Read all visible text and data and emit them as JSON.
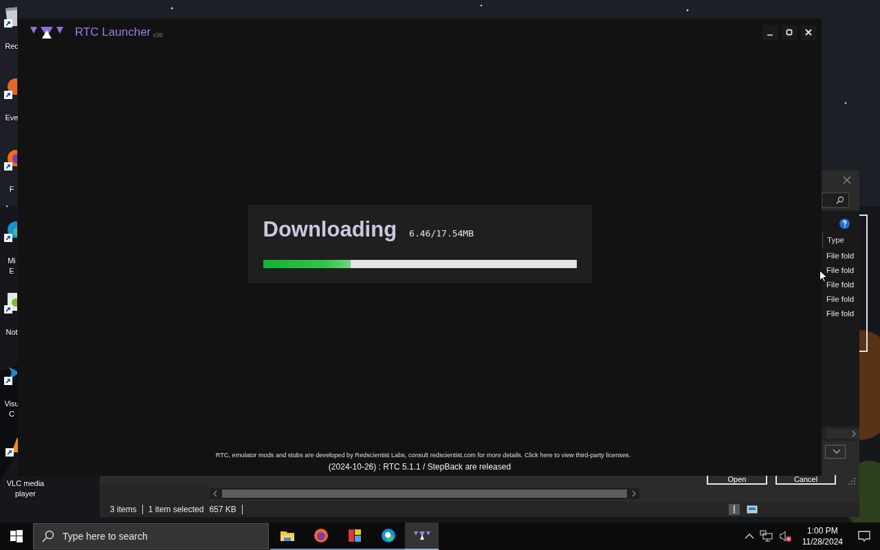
{
  "desktop": {
    "icons": [
      {
        "kind": "recycle",
        "lines": [
          "Rec"
        ]
      },
      {
        "kind": "orange",
        "lines": [
          "Eve"
        ]
      },
      {
        "kind": "firefox",
        "lines": [
          "F"
        ]
      },
      {
        "kind": "edge",
        "lines": [
          "Mi",
          "E"
        ]
      },
      {
        "kind": "notepad",
        "lines": [
          "Not"
        ]
      },
      {
        "kind": "vscode",
        "lines": [
          "Visu",
          "C"
        ]
      },
      {
        "kind": "vlc",
        "lines": [
          "VLC media",
          "player"
        ]
      }
    ]
  },
  "file_dialog": {
    "column_header": "Type",
    "rows": [
      "File fold",
      "File fold",
      "File fold",
      "File fold",
      "File fold"
    ],
    "buttons": [
      "Open",
      "Cancel"
    ],
    "status": {
      "items": "3 items",
      "selection": "1 item selected",
      "size": "657 KB"
    }
  },
  "launcher": {
    "title": "RTC Launcher",
    "version": "v36",
    "download": {
      "heading": "Downloading",
      "amount": "6.46/17.54MB",
      "level": 0.28
    },
    "notice": "RTC, emulator mods and stubs are developed by Redscientist Labs, consult redscientist.com for more details. Click here to view third-party licenses.",
    "release": "(2024-10-26) : RTC 5.1.1 / StepBack are released"
  },
  "taskbar": {
    "search": {
      "placeholder": "Type here to search"
    },
    "apps": [
      {
        "kind": "folder",
        "selected": false
      },
      {
        "kind": "firefox",
        "selected": false
      },
      {
        "kind": "tiles",
        "selected": false
      },
      {
        "kind": "edge",
        "selected": false
      },
      {
        "kind": "rtc",
        "selected": true
      }
    ],
    "clock": {
      "time": "1:00 PM",
      "date": "11/28/2024"
    }
  }
}
